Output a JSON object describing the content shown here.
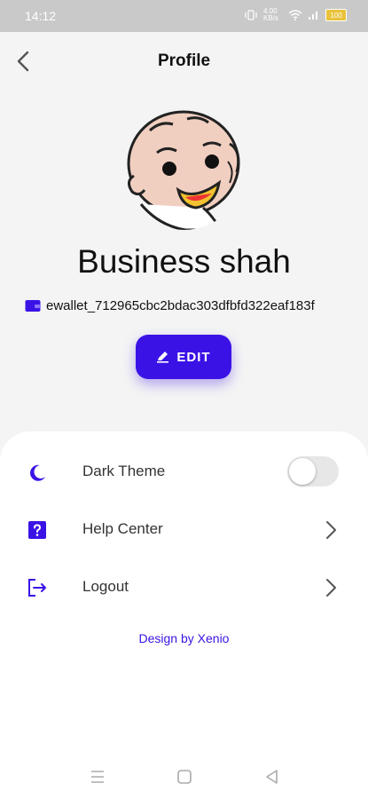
{
  "status": {
    "time": "14:12",
    "net": "4.00 KB/s",
    "battery": "100"
  },
  "header": {
    "title": "Profile"
  },
  "profile": {
    "name": "Business shah",
    "wallet": "ewallet_712965cbc2bdac303dfbfd322eaf183f"
  },
  "actions": {
    "edit_label": "EDIT"
  },
  "settings": [
    {
      "label": "Dark Theme",
      "icon": "moon-icon",
      "control": "toggle",
      "enabled": false
    },
    {
      "label": "Help Center",
      "icon": "question-icon",
      "control": "chevron"
    },
    {
      "label": "Logout",
      "icon": "logout-icon",
      "control": "chevron"
    }
  ],
  "footer": {
    "credit": "Design by Xenio"
  },
  "colors": {
    "accent": "#3b12e6",
    "background": "#f4f4f4",
    "panel": "#ffffff"
  }
}
